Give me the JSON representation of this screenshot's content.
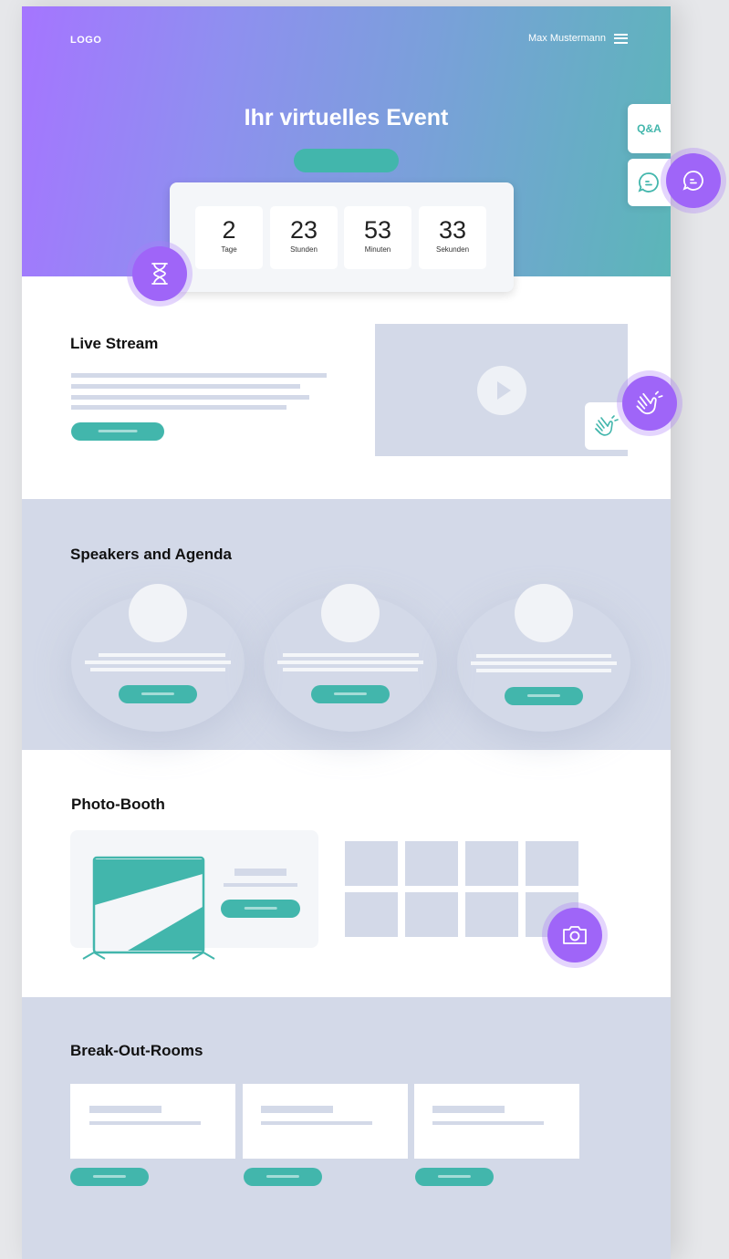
{
  "header": {
    "logo": "LOGO",
    "user_name": "Max Mustermann"
  },
  "hero": {
    "title": "Ihr virtuelles Event"
  },
  "countdown": [
    {
      "value": "2",
      "label": "Tage"
    },
    {
      "value": "23",
      "label": "Stunden"
    },
    {
      "value": "53",
      "label": "Minuten"
    },
    {
      "value": "33",
      "label": "Sekunden"
    }
  ],
  "side_dock": {
    "qa_label": "Q&A"
  },
  "sections": {
    "live_stream": "Live Stream",
    "speakers": "Speakers and Agenda",
    "photo_booth": "Photo-Booth",
    "breakout": "Break-Out-Rooms"
  },
  "icons": [
    "hourglass-icon",
    "chat-bubble-icon",
    "clapping-hands-icon",
    "camera-icon",
    "play-icon",
    "menu-icon"
  ],
  "colors": {
    "accent_teal": "#42b6ac",
    "accent_purple": "#9f65f8",
    "placeholder": "#d3d9e8"
  }
}
